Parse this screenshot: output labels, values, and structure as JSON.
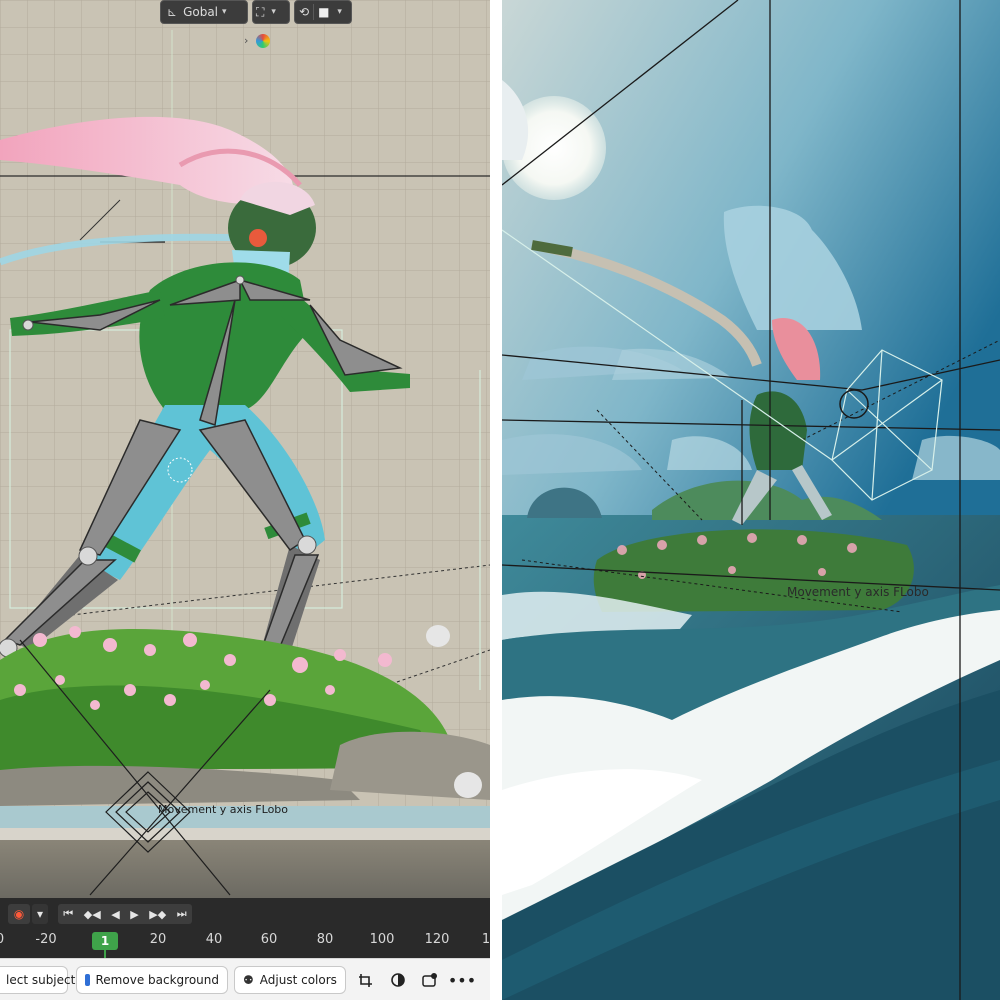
{
  "viewport": {
    "orientation_label": "Gobal",
    "overlay_caption": "Movement y axis FLobo"
  },
  "render": {
    "overlay_caption": "Movement y axis FLobo"
  },
  "timeline": {
    "current_frame": "1",
    "ticks": [
      "0",
      "-20",
      "20",
      "40",
      "60",
      "80",
      "100",
      "120",
      "1"
    ]
  },
  "toolbar": {
    "select_subject": "lect subject",
    "remove_background": "Remove background",
    "adjust_colors": "Adjust colors"
  },
  "colors": {
    "viewport_bg": "#c9c3b4",
    "grid": "#b3ac9d",
    "jacket_green": "#2e8b3a",
    "pants_blue": "#5fc3d6",
    "bone_gray": "#8e8e8e",
    "frame_badge": "#3fa34a",
    "sky_blue": "#2e7fa6",
    "sea_teal": "#1f5b66"
  }
}
